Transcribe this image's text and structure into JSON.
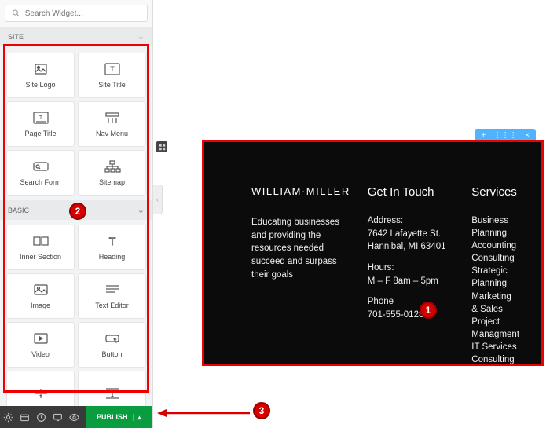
{
  "search": {
    "placeholder": "Search Widget..."
  },
  "sections": {
    "site": "SITE",
    "basic": "BASIC"
  },
  "widgets": {
    "site": [
      {
        "key": "site-logo",
        "label": "Site Logo",
        "icon": "logo"
      },
      {
        "key": "site-title",
        "label": "Site Title",
        "icon": "title"
      },
      {
        "key": "page-title",
        "label": "Page Title",
        "icon": "pagetitle"
      },
      {
        "key": "nav-menu",
        "label": "Nav Menu",
        "icon": "navmenu"
      },
      {
        "key": "search-form",
        "label": "Search Form",
        "icon": "searchform"
      },
      {
        "key": "sitemap",
        "label": "Sitemap",
        "icon": "sitemap"
      }
    ],
    "basic": [
      {
        "key": "inner-section",
        "label": "Inner Section",
        "icon": "innersec"
      },
      {
        "key": "heading",
        "label": "Heading",
        "icon": "heading"
      },
      {
        "key": "image",
        "label": "Image",
        "icon": "image"
      },
      {
        "key": "text-editor",
        "label": "Text Editor",
        "icon": "texteditor"
      },
      {
        "key": "video",
        "label": "Video",
        "icon": "video"
      },
      {
        "key": "button",
        "label": "Button",
        "icon": "button"
      },
      {
        "key": "divider",
        "label": "",
        "icon": "divider"
      },
      {
        "key": "spacer",
        "label": "",
        "icon": "spacer"
      }
    ]
  },
  "publish": {
    "label": "PUBLISH"
  },
  "annotations": {
    "b1": "1",
    "b2": "2",
    "b3": "3"
  },
  "footer": {
    "brand": "WILLIAM·MILLER",
    "about": "Educating businesses and providing the resources needed succeed and surpass their goals",
    "contact": {
      "title": "Get In Touch",
      "address_label": "Address:",
      "address1": "7642 Lafayette St.",
      "address2": "Hannibal, MI 63401",
      "hours_label": "Hours:",
      "hours": "M – F 8am – 5pm",
      "phone_label": "Phone",
      "phone": "701-555-0128"
    },
    "services": {
      "title": "Services",
      "items": [
        "Business Planning",
        "Accounting",
        "Consulting",
        "Strategic Planning",
        "Marketing & Sales",
        "Project Managment",
        "IT Services",
        "Consulting"
      ]
    }
  }
}
